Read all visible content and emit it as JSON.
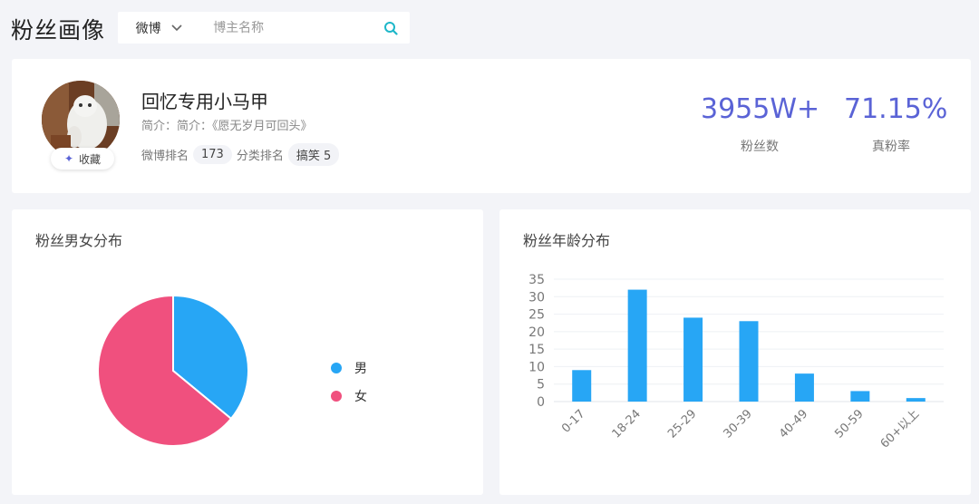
{
  "header": {
    "title": "粉丝画像",
    "platform_selected": "微博",
    "search_placeholder": "博主名称"
  },
  "profile": {
    "name": "回忆专用小马甲",
    "intro": "简介：简介：《愿无岁月可回头》",
    "favorite_label": "收藏",
    "weibo_rank_label": "微博排名",
    "weibo_rank_value": "173",
    "category_rank_label": "分类排名",
    "category_value": "搞笑 5"
  },
  "stats": [
    {
      "value": "3955W+",
      "label": "粉丝数"
    },
    {
      "value": "71.15%",
      "label": "真粉率"
    }
  ],
  "gender_panel": {
    "title": "粉丝男女分布",
    "legend": [
      {
        "label": "男",
        "color": "#27a6f5"
      },
      {
        "label": "女",
        "color": "#f0507e"
      }
    ]
  },
  "age_panel": {
    "title": "粉丝年龄分布"
  },
  "colors": {
    "accent": "#5a63d6",
    "male": "#27a6f5",
    "female": "#f0507e",
    "bar": "#27a6f5",
    "search_icon": "#1eb7c9"
  },
  "chart_data": [
    {
      "type": "pie",
      "categories": [
        "男",
        "女"
      ],
      "values": [
        36,
        64
      ],
      "legend_position": "right"
    },
    {
      "type": "bar",
      "categories": [
        "0-17",
        "18-24",
        "25-29",
        "30-39",
        "40-49",
        "50-59",
        "60+以上"
      ],
      "values": [
        9,
        32,
        24,
        23,
        8,
        3,
        1
      ],
      "ylim": [
        0,
        35
      ],
      "yticks": [
        0,
        5,
        10,
        15,
        20,
        25,
        30,
        35
      ],
      "grid": true
    }
  ]
}
